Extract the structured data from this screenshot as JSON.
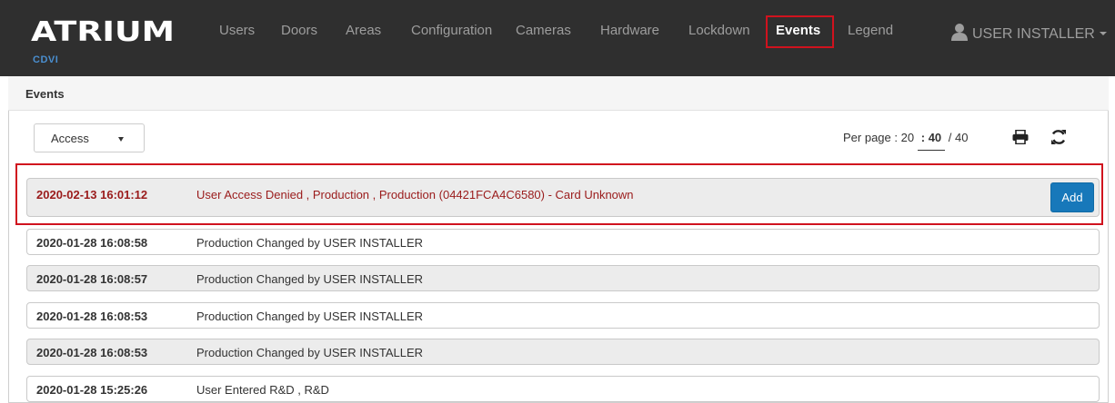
{
  "brand": {
    "logo": "ATRIUM",
    "subtitle": "CDVI"
  },
  "nav": {
    "items": [
      {
        "label": "Users"
      },
      {
        "label": "Doors"
      },
      {
        "label": "Areas"
      },
      {
        "label": "Configuration"
      },
      {
        "label": "Cameras"
      },
      {
        "label": "Hardware"
      },
      {
        "label": "Lockdown"
      },
      {
        "label": "Events",
        "active": true
      },
      {
        "label": "Legend"
      }
    ],
    "user": "USER INSTALLER"
  },
  "panel": {
    "title": "Events",
    "filter": "Access",
    "per_page": {
      "label": "Per page",
      "sep": ":",
      "options": [
        "20",
        "40"
      ],
      "current": "40",
      "total": "40"
    }
  },
  "events": [
    {
      "date": "2020-02-13 16:01:12",
      "description": "User Access Denied , Production , Production (04421FCA4C6580) - Card Unknown",
      "action": "Add"
    },
    {
      "date": "2020-01-28 16:08:58",
      "description": "Production Changed by USER INSTALLER"
    },
    {
      "date": "2020-01-28 16:08:57",
      "description": "Production Changed by USER INSTALLER"
    },
    {
      "date": "2020-01-28 16:08:53",
      "description": "Production Changed by USER INSTALLER"
    },
    {
      "date": "2020-01-28 16:08:53",
      "description": "Production Changed by USER INSTALLER"
    },
    {
      "date": "2020-01-28 15:25:26",
      "description": "User Entered R&D , R&D"
    }
  ],
  "colors": {
    "navbar": "#2f2f2f",
    "highlight": "#d0121e",
    "denied_text": "#9a1b1b",
    "button": "#1778ba"
  }
}
